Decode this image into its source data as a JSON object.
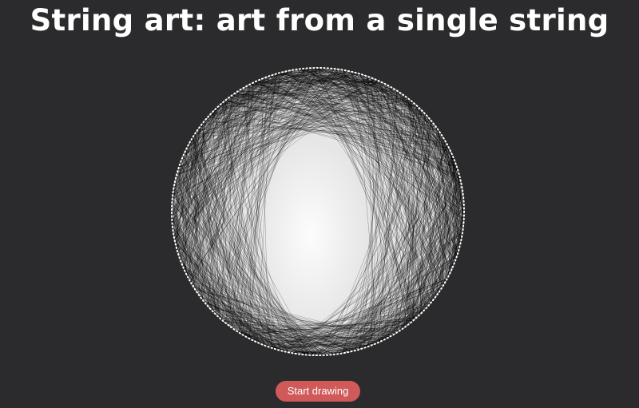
{
  "page": {
    "title": "String art: art from a single string"
  },
  "canvas": {
    "subject": "string-art-portrait",
    "colors": {
      "background": "#2b2b2d",
      "canvas_fill": "#e6e6e6",
      "string": "#000000",
      "border_dots": "#ffffff"
    }
  },
  "controls": {
    "start_label": "Start drawing",
    "start_color": "#d05a5a"
  }
}
